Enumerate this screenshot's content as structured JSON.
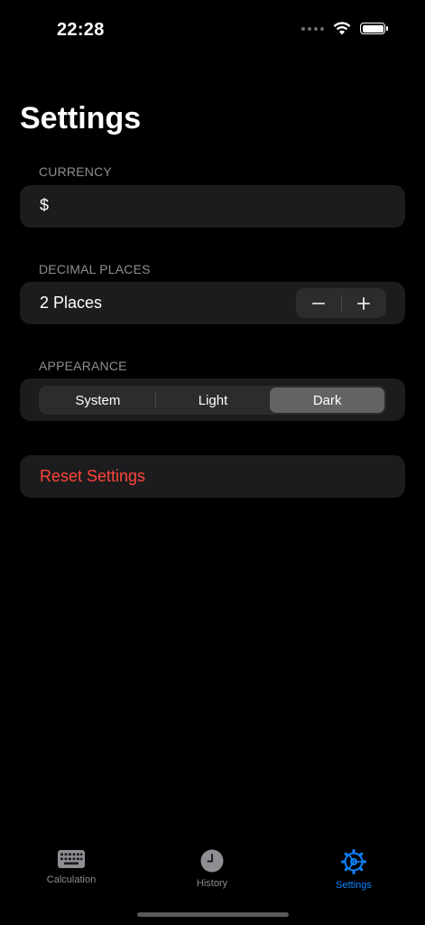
{
  "status_bar": {
    "time": "22:28"
  },
  "page": {
    "title": "Settings"
  },
  "currency": {
    "header": "CURRENCY",
    "value": "$"
  },
  "decimal_places": {
    "header": "DECIMAL PLACES",
    "label": "2 Places",
    "value": 2,
    "decrement_icon": "minus-icon",
    "increment_icon": "plus-icon"
  },
  "appearance": {
    "header": "APPEARANCE",
    "options": [
      "System",
      "Light",
      "Dark"
    ],
    "selected": "Dark"
  },
  "reset": {
    "label": "Reset Settings",
    "color": "#ff453a"
  },
  "tab_bar": {
    "tabs": [
      {
        "label": "Calculation",
        "icon": "keyboard-icon",
        "active": false
      },
      {
        "label": "History",
        "icon": "clock-icon",
        "active": false
      },
      {
        "label": "Settings",
        "icon": "gear-icon",
        "active": true
      }
    ],
    "active_color": "#0a84ff",
    "inactive_color": "#8e8e93"
  }
}
